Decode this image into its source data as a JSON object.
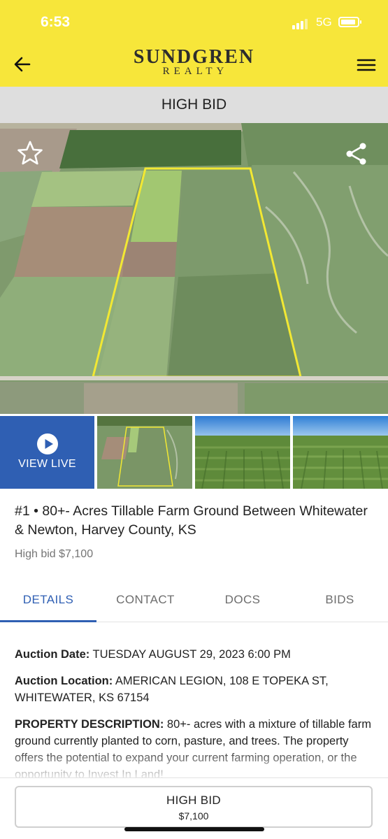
{
  "status_bar": {
    "time": "6:53",
    "network": "5G"
  },
  "header": {
    "logo_main": "SUNDGREN",
    "logo_sub": "REALTY",
    "back_icon": "arrow-left-icon",
    "menu_icon": "hamburger-menu-icon"
  },
  "page_title": "HIGH BID",
  "hero": {
    "favorite_icon": "star-outline-icon",
    "share_icon": "share-icon"
  },
  "gallery": {
    "view_live_label": "VIEW LIVE",
    "play_icon": "play-circle-icon"
  },
  "lot": {
    "title": "#1 • 80+- Acres Tillable Farm Ground Between Whitewater & Newton, Harvey County, KS",
    "high_bid_text": "High bid $7,100"
  },
  "tabs": [
    {
      "label": "DETAILS",
      "active": true
    },
    {
      "label": "CONTACT",
      "active": false
    },
    {
      "label": "DOCS",
      "active": false
    },
    {
      "label": "BIDS",
      "active": false
    }
  ],
  "details": {
    "auction_date_label": "Auction Date:",
    "auction_date_value": " TUESDAY AUGUST 29, 2023 6:00 PM",
    "auction_location_label": "Auction Location:",
    "auction_location_value": " AMERICAN LEGION, 108 E TOPEKA ST, WHITEWATER, KS 67154",
    "property_description_label": "PROPERTY DESCRIPTION:",
    "property_description_value": " 80+- acres with a mixture of tillable farm ground currently planted to corn, pasture, and trees. The property offers the potential to expand your current farming operation, or the opportunity to Invest In Land!"
  },
  "footer": {
    "button_label": "HIGH BID",
    "button_amount": "$7,100"
  },
  "colors": {
    "brand_yellow": "#f7e63a",
    "accent_blue": "#2f5fb3",
    "header_gray": "#dedede"
  }
}
